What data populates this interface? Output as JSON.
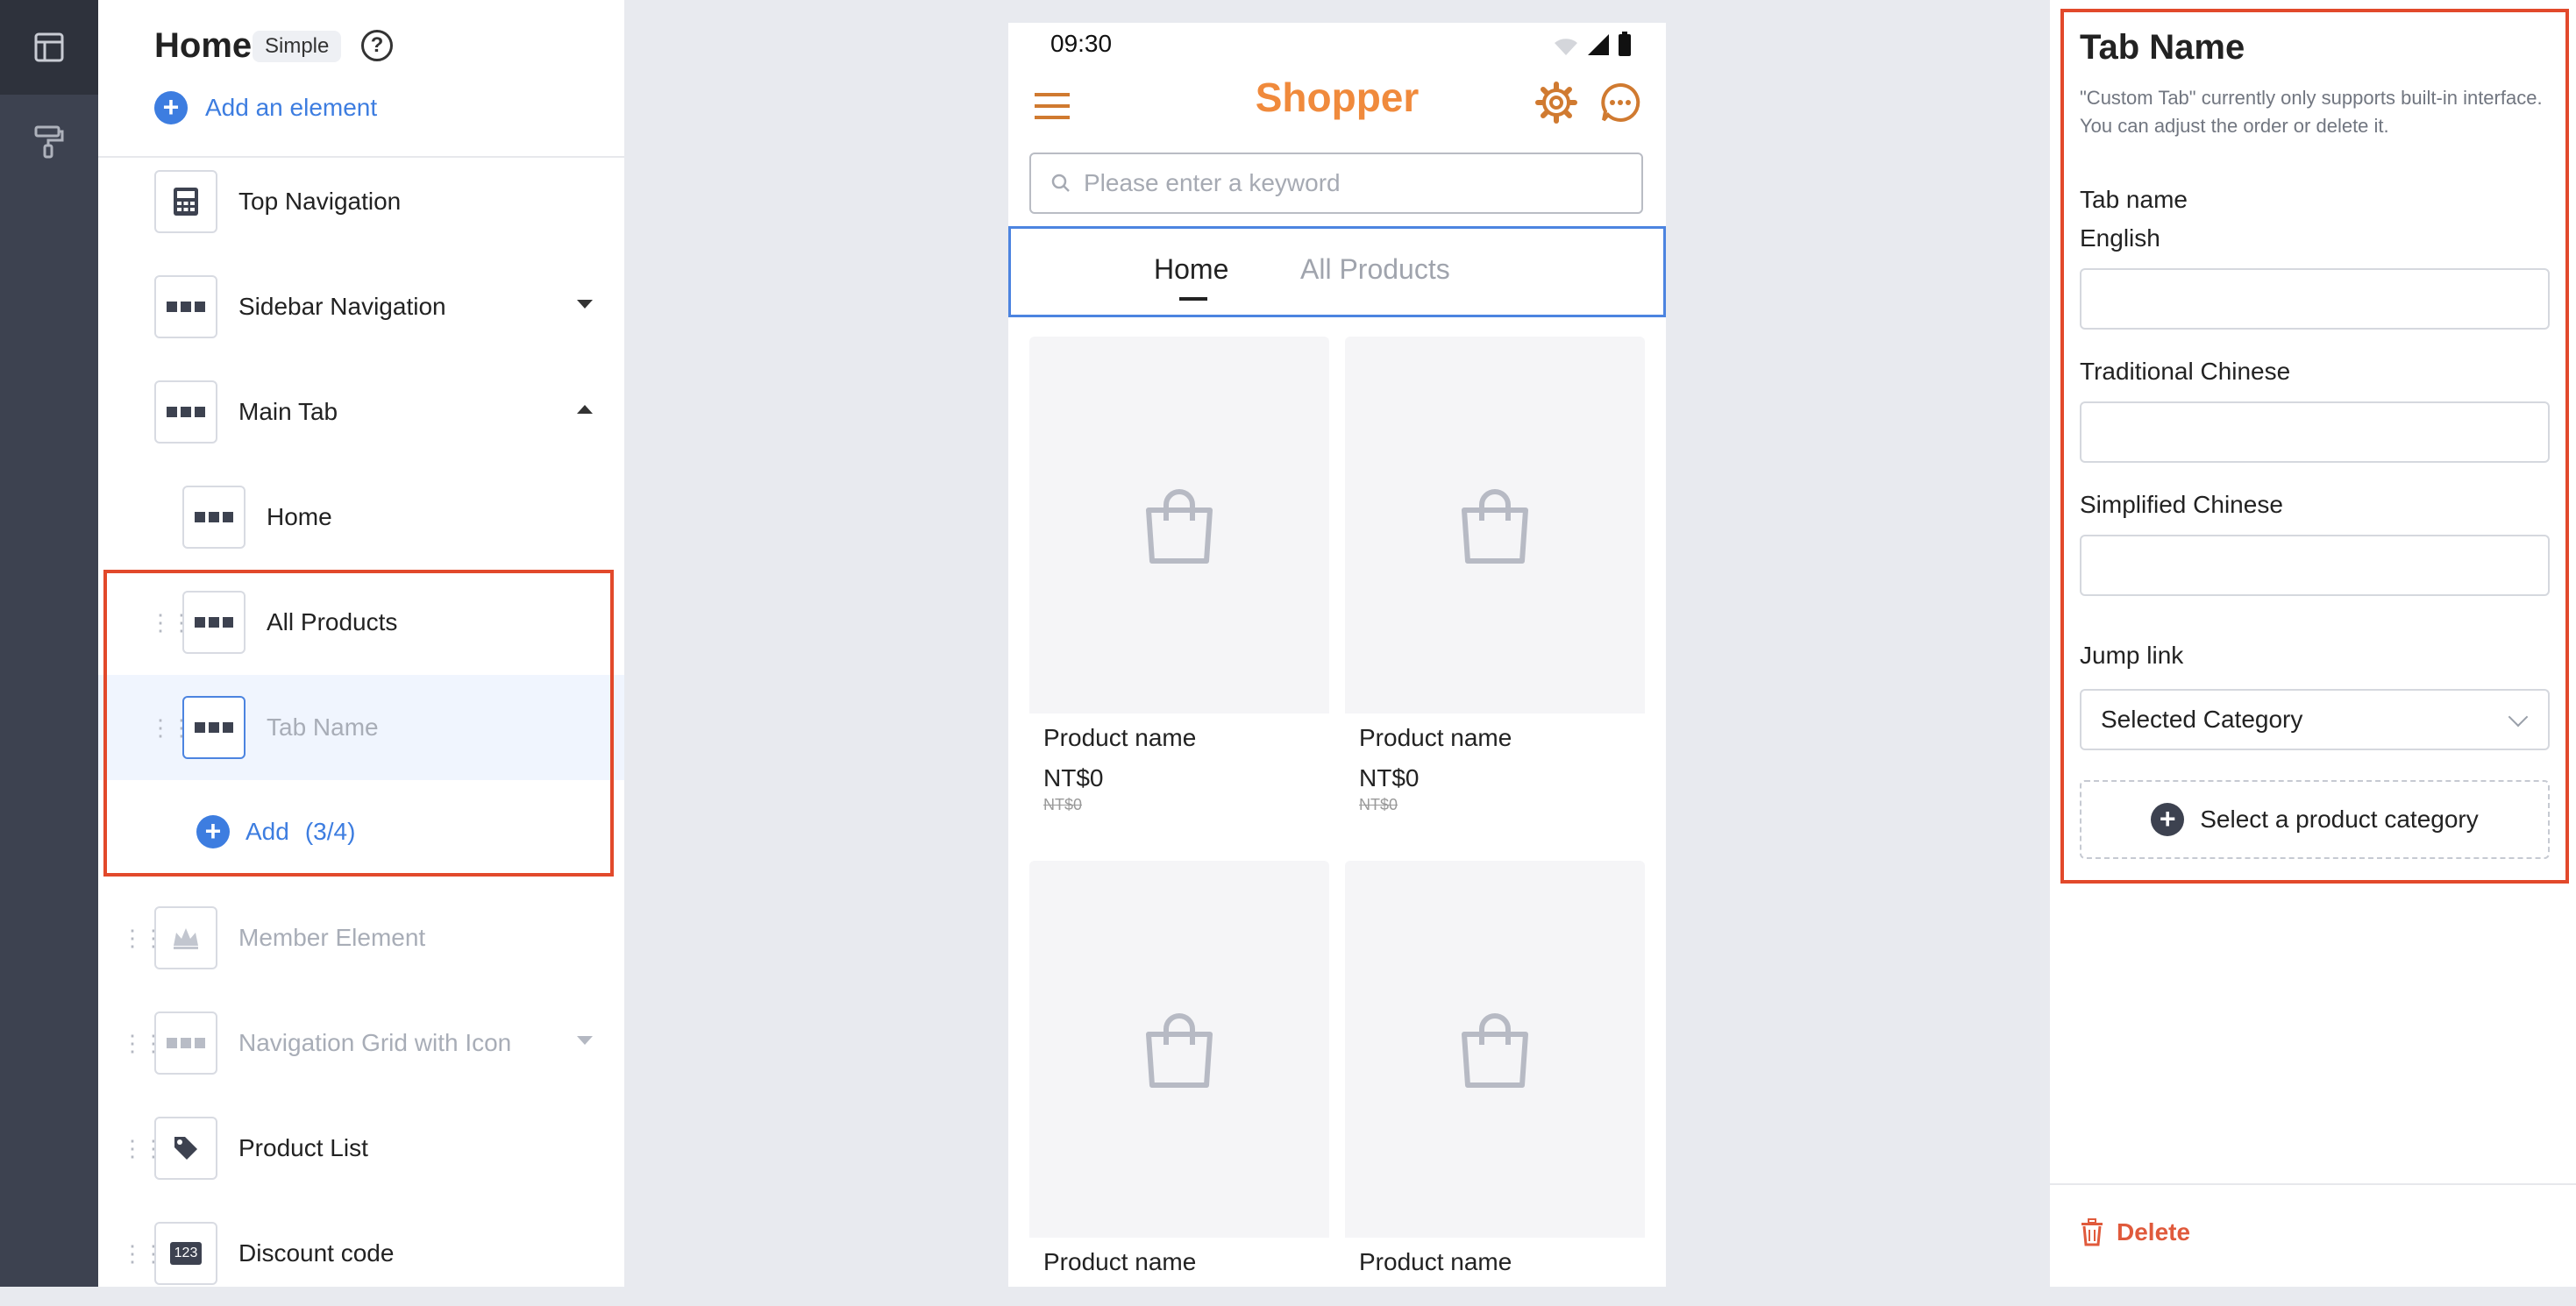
{
  "panel": {
    "title": "Home",
    "mode_badge": "Simple",
    "help_glyph": "?",
    "add_element": "Add an element",
    "items": [
      {
        "label": "Top Navigation",
        "icon": "calculator-icon"
      },
      {
        "label": "Sidebar Navigation",
        "icon": "grid-icon",
        "expandable": true
      },
      {
        "label": "Main Tab",
        "icon": "grid-icon",
        "expanded": true
      },
      {
        "label": "Home",
        "icon": "grid-icon"
      },
      {
        "label": "All Products",
        "icon": "grid-icon"
      },
      {
        "label": "Tab Name",
        "icon": "grid-icon",
        "selected": true
      },
      {
        "label": "Member Element",
        "icon": "crown-icon",
        "disabled": true
      },
      {
        "label": "Navigation Grid with Icon",
        "icon": "grid-icon",
        "disabled": true
      },
      {
        "label": "Product List",
        "icon": "tag-icon"
      },
      {
        "label": "Discount code",
        "icon": "coupon-icon",
        "icon_text": "123"
      }
    ],
    "add_tab": "Add",
    "add_tab_count": "(3/4)"
  },
  "phone": {
    "time": "09:30",
    "logo": "Shopper",
    "search_placeholder": "Please enter a keyword",
    "tabs": [
      "Home",
      "All Products"
    ],
    "products": [
      {
        "name": "Product name",
        "price": "NT$0",
        "original_price": "NT$0"
      },
      {
        "name": "Product name",
        "price": "NT$0",
        "original_price": "NT$0"
      },
      {
        "name": "Product name"
      },
      {
        "name": "Product name"
      }
    ]
  },
  "settings": {
    "title": "Tab Name",
    "description": "\"Custom Tab\" currently only supports built-in interface. You can adjust the order or delete it.",
    "tab_name_label": "Tab name",
    "lang_english": "English",
    "lang_traditional": "Traditional Chinese",
    "lang_simplified": "Simplified Chinese",
    "jump_link_label": "Jump link",
    "jump_link_value": "Selected Category",
    "select_category": "Select a product category",
    "delete": "Delete"
  },
  "colors": {
    "accent": "#3d7de0",
    "highlight_border": "#e2492b",
    "logo": "#f08a3c",
    "rail": "#3d4250",
    "danger": "#e05a3c"
  }
}
